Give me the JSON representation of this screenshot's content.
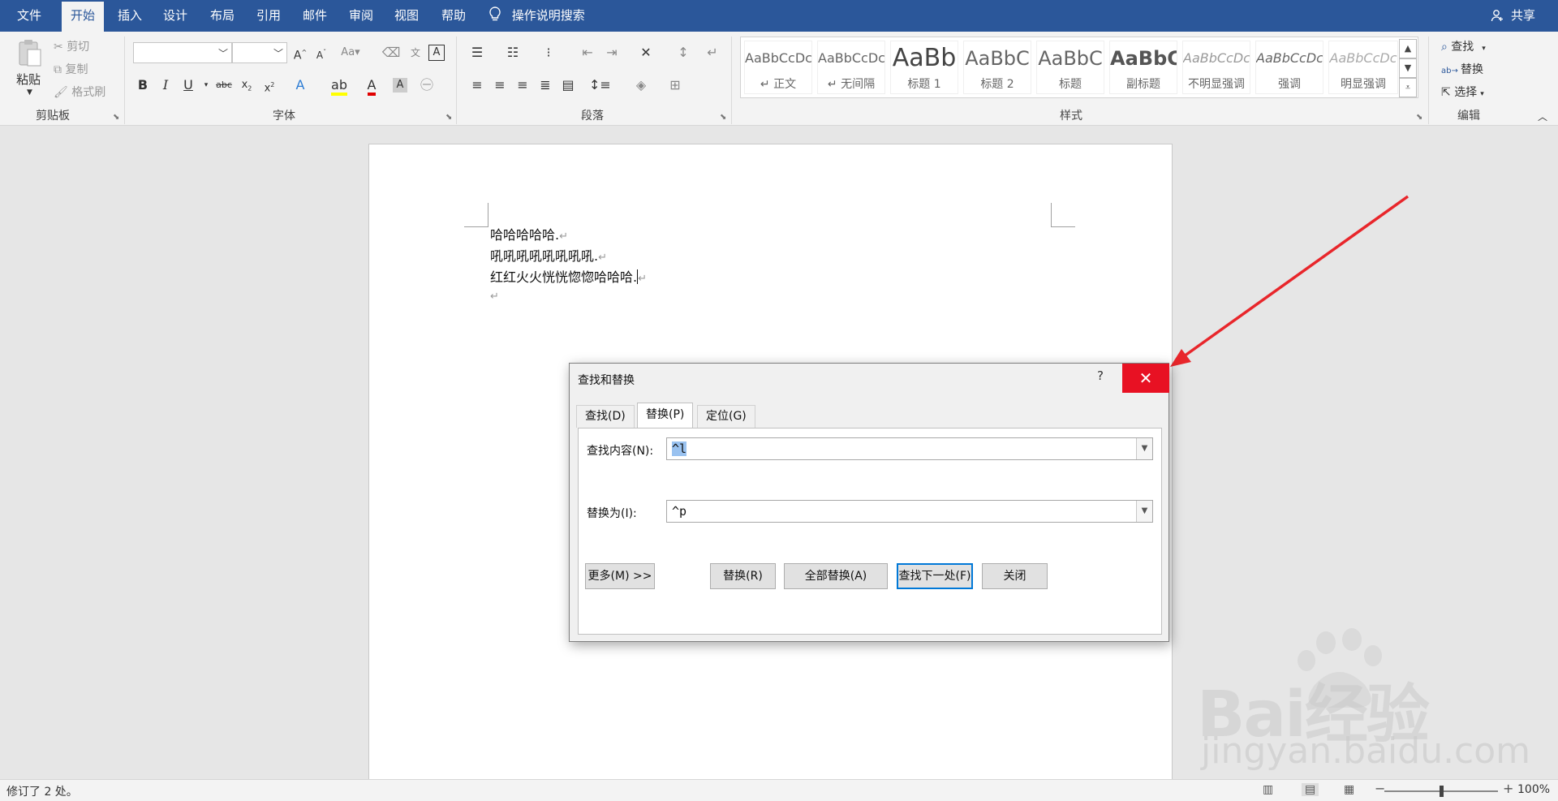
{
  "menu": {
    "items": [
      "文件",
      "开始",
      "插入",
      "设计",
      "布局",
      "引用",
      "邮件",
      "审阅",
      "视图",
      "帮助"
    ],
    "active": "开始",
    "search_label": "操作说明搜索",
    "share_label": "共享"
  },
  "ribbon": {
    "clipboard": {
      "paste": "粘贴",
      "cut": "剪切",
      "copy": "复制",
      "format_painter": "格式刷",
      "label": "剪贴板"
    },
    "font": {
      "label": "字体"
    },
    "paragraph": {
      "label": "段落"
    },
    "styles": {
      "label": "样式",
      "tiles": [
        {
          "sample": "AaBbCcDc",
          "name": "↵ 正文"
        },
        {
          "sample": "AaBbCcDc",
          "name": "↵ 无间隔"
        },
        {
          "sample": "AaBb",
          "name": "标题 1"
        },
        {
          "sample": "AaBbC",
          "name": "标题 2"
        },
        {
          "sample": "AaBbC",
          "name": "标题"
        },
        {
          "sample": "AaBbC",
          "name": "副标题"
        },
        {
          "sample": "AaBbCcDc",
          "name": "不明显强调"
        },
        {
          "sample": "AaBbCcDc",
          "name": "强调"
        },
        {
          "sample": "AaBbCcDc",
          "name": "明显强调"
        }
      ]
    },
    "editing": {
      "find": "查找",
      "replace": "替换",
      "select": "选择",
      "label": "编辑"
    }
  },
  "document": {
    "lines": [
      "哈哈哈哈哈.",
      "吼吼吼吼吼吼吼吼.",
      "红红火火恍恍惚惚哈哈哈.",
      ""
    ],
    "paragraph_mark": "↵"
  },
  "dialog": {
    "title": "查找和替换",
    "help": "?",
    "close": "✕",
    "tabs": [
      "查找(D)",
      "替换(P)",
      "定位(G)"
    ],
    "active_tab": "替换(P)",
    "find_label": "查找内容(N):",
    "find_value": "^l",
    "replace_label": "替换为(I):",
    "replace_value": "^p",
    "buttons": {
      "more": "更多(M) >>",
      "replace": "替换(R)",
      "replace_all": "全部替换(A)",
      "find_next": "查找下一处(F)",
      "close": "关闭"
    }
  },
  "watermark": {
    "line1": "Bai经验",
    "line2": "jingyan.baidu.com"
  },
  "status": {
    "text": "修订了 2 处。",
    "zoom": "100%"
  },
  "colors": {
    "accent": "#2b579a",
    "close_red": "#e81123",
    "annotation_red": "#e8262b",
    "default_button_border": "#0078d7"
  }
}
